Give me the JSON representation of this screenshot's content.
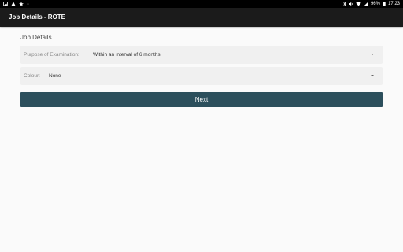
{
  "status_bar": {
    "left_icons": [
      "image-icon",
      "warning-icon",
      "star-icon",
      "dot-icon"
    ],
    "right_icons": [
      "bluetooth-icon",
      "mute-icon",
      "wifi-icon",
      "signal-icon"
    ],
    "battery": "96%",
    "time": "17:23"
  },
  "app_bar": {
    "title": "Job Details - ROTE"
  },
  "form": {
    "section_title": "Job Details",
    "purpose": {
      "label": "Purpose of Examination:",
      "value": "Within an interval of 6 months"
    },
    "colour": {
      "label": "Colour:",
      "value": "None"
    },
    "next_label": "Next"
  },
  "colors": {
    "status_bar": "#000000",
    "app_bar": "#1b1b1b",
    "background": "#fafafa",
    "field_bg": "#f0f0f0",
    "button": "#2c4f5c"
  }
}
